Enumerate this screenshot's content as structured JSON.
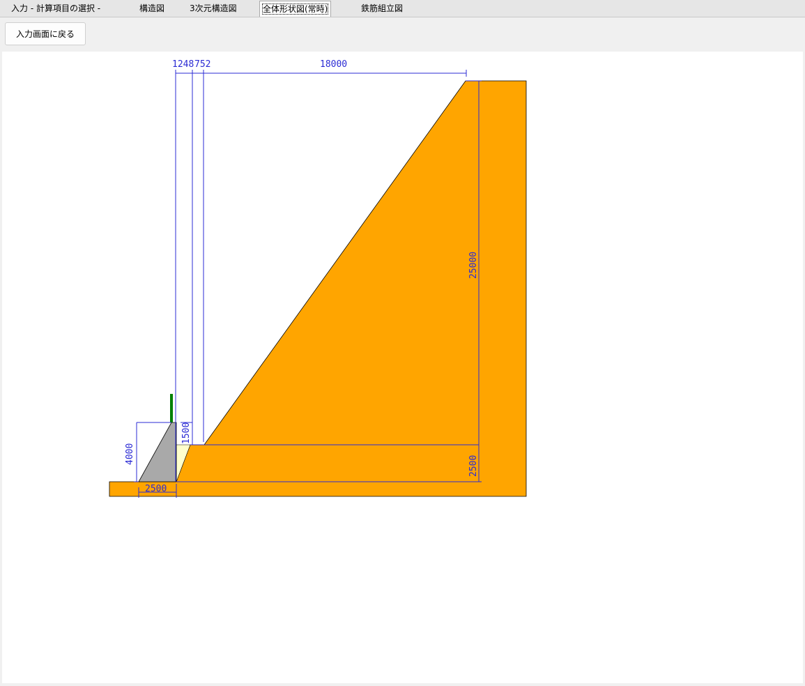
{
  "tabs": [
    {
      "label": "入力 - 計算項目の選択 -"
    },
    {
      "label": "構造図"
    },
    {
      "label": "3次元構造図"
    },
    {
      "label": "全体形状図(常時)"
    },
    {
      "label": "鉄筋組立図"
    }
  ],
  "toolbar": {
    "back_label": "入力画面に戻る"
  },
  "drawing": {
    "dims": {
      "top_a": "1248",
      "top_b": "752",
      "top_width": "18000",
      "right_height": "25000",
      "right_base": "2500",
      "wall_height": "4000",
      "bottom_width": "2500",
      "step_height": "1500"
    },
    "colors": {
      "fill": "#ffa500",
      "wall": "#a9a9a9",
      "sand": "#ffffcc",
      "dim_line": "#2b2bd4",
      "post": "#008000"
    }
  }
}
